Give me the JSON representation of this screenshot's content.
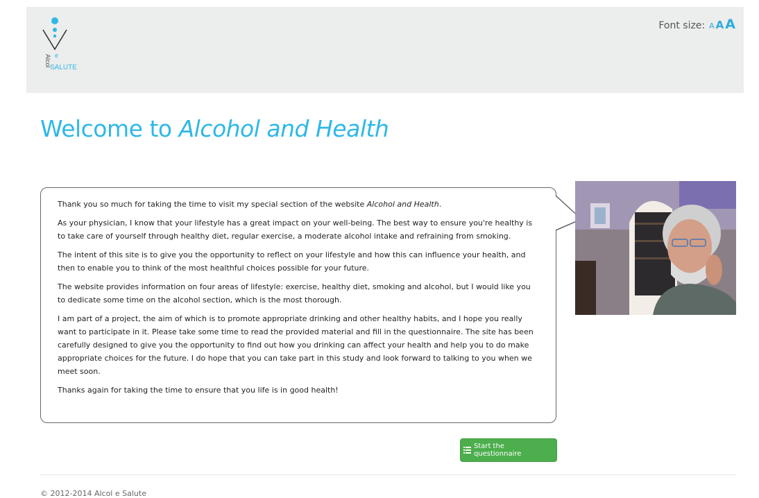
{
  "header": {
    "logo_text": "Alcol e SALUTE",
    "font_size_label": "Font size:",
    "font_size_options": [
      "A",
      "A",
      "A"
    ]
  },
  "title": {
    "prefix": "Welcome to ",
    "emphasis": "Alcohol and Health"
  },
  "message": {
    "p1_prefix": "Thank you so much for taking the time to visit my special section of the website ",
    "p1_site": "Alcohol and Health",
    "p1_suffix": ".",
    "p2": "As your physician, I know that your lifestyle has a great impact on your well-being. The best way to ensure you're healthy is to take care of yourself through healthy diet, regular exercise, a moderate alcohol intake and refraining from smoking.",
    "p3": "The intent of this site is to give you the opportunity to reflect on your lifestyle and how this can influence your health, and then to enable you to think of the most healthful choices possible for your future.",
    "p4": "The website provides information on four areas of lifestyle: exercise, healthy diet, smoking and alcohol, but I would like you to dedicate some time on the alcohol section, which is the most thorough.",
    "p5": "I am part of a project, the aim of which is to promote appropriate drinking and other healthy habits, and I hope you really want to participate in it. Please take some time to read the provided material and fill in the questionnaire. The site has been carefully designed to give you the opportunity to find out how you drinking can affect your health and help you to do make appropriate choices for the future. I do hope that you can take part in this study and look forward to talking to you when we meet soon.",
    "p6": "Thanks again for taking the time to ensure that you life is in good health!"
  },
  "start_button": {
    "label": "Start the questionnaire",
    "icon": "list-icon"
  },
  "footer": {
    "copyright": "© 2012-2014 Alcol e Salute"
  },
  "colors": {
    "accent": "#2eb8e6",
    "button": "#4cae4c",
    "header_bg": "#eceded"
  }
}
